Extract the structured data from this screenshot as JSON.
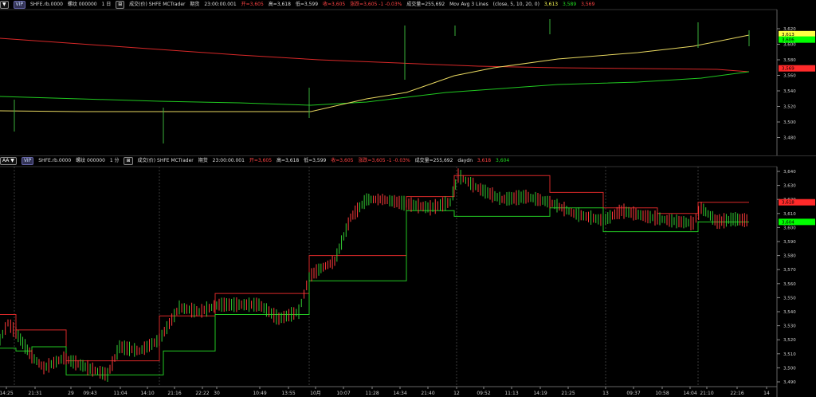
{
  "top": {
    "header": {
      "dropdown": "▼",
      "vip": "VIP",
      "symbol": "SHFE.rb.0000",
      "spread": "螺纹 000000",
      "period": "1 日",
      "zoom": "⊞",
      "source": "成交(价)  SHFE  MCTrader",
      "tag_exp": "期货",
      "time": "23:00:00.001",
      "open": "开=3,605",
      "high": "高=3,618",
      "low": "低=3,599",
      "close": "收=3,605",
      "change": "涨跌=3,605 -1 -0.03%",
      "volume": "成交量=255,692",
      "indicator": "Mov Avg 3 Lines",
      "params": "(close,  5,  10,  20,  0)",
      "val1": "3,613",
      "val2": "3,589",
      "val3": "3,569"
    },
    "price_labels": [
      "3,620",
      "3,600",
      "3,580",
      "3,560",
      "3,540",
      "3,520",
      "3,500",
      "3,480"
    ],
    "tags": [
      {
        "text": "3,613",
        "color": "#ffff44",
        "price": 3613
      },
      {
        "text": "3,606",
        "color": "#00ff00",
        "price": 3606
      },
      {
        "text": "3,569",
        "color": "#ff2a2a",
        "price": 3569
      }
    ]
  },
  "bottom": {
    "header": {
      "dropdown": "AA ▼",
      "vip": "VIP",
      "symbol": "SHFE.rb.0000",
      "spread": "螺纹 000000",
      "period": "1 分",
      "zoom": "⊞",
      "source": "成交(价)  SHFE  MCTrader",
      "tag_exp": "期货",
      "time": "23:00:00.001",
      "open": "开=3,605",
      "high": "高=3,618",
      "low": "低=3,599",
      "close": "收=3,605",
      "change": "涨跌=3,605 -1 -0.03%",
      "volume": "成交量=255,692",
      "indicator": "daydn",
      "val1": "3,618",
      "val2": "3,604"
    },
    "price_labels": [
      "3,640",
      "3,630",
      "3,620",
      "3,610",
      "3,600",
      "3,590",
      "3,580",
      "3,570",
      "3,560",
      "3,550",
      "3,540",
      "3,530",
      "3,520",
      "3,510",
      "3,500",
      "3,490"
    ],
    "tags": [
      {
        "text": "3,618",
        "color": "#ff2a2a",
        "price": 3618
      },
      {
        "text": "3,604",
        "color": "#00ff00",
        "price": 3604
      }
    ],
    "time_labels": [
      "14:25",
      "21:31",
      "29",
      "09:43",
      "11:04",
      "14:10",
      "21:16",
      "22:22",
      "30",
      "10:49",
      "13:55",
      "10月",
      "10:07",
      "11:28",
      "14:34",
      "21:40",
      "12",
      "09:52",
      "11:13",
      "14:19",
      "21:25",
      "13",
      "09:37",
      "10:58",
      "14:04",
      "21:10",
      "22:16",
      "14"
    ]
  }
}
